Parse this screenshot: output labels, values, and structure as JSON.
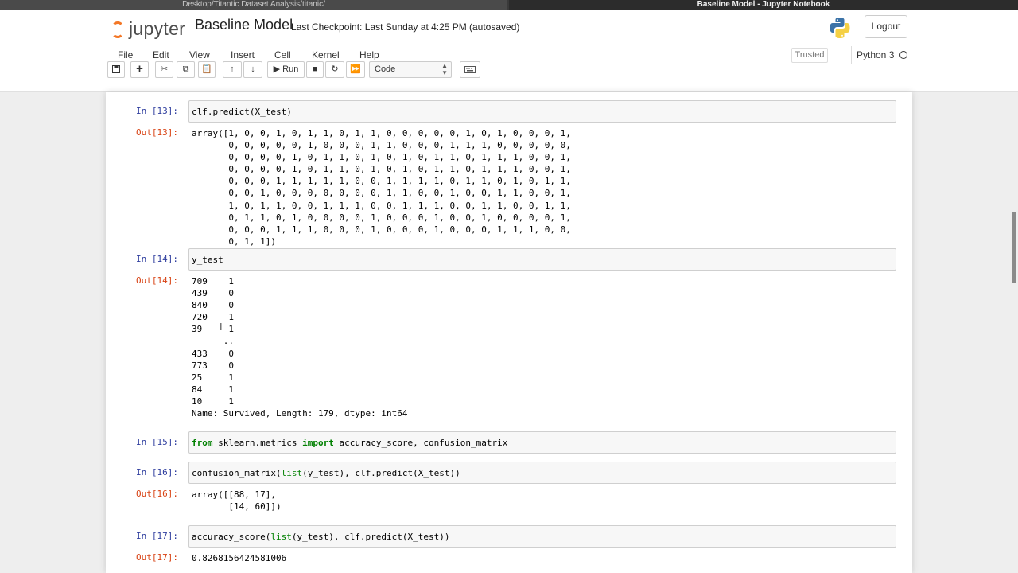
{
  "browser": {
    "tab1_title": "Desktop/Titantic Dataset Analysis/titanic/",
    "tab2_title": "Baseline Model - Jupyter Notebook"
  },
  "header": {
    "logo_text": "jupyter",
    "notebook_title": "Baseline Model",
    "checkpoint": "Last Checkpoint: Last Sunday at 4:25 PM",
    "autosaved": "(autosaved)",
    "logout_label": "Logout"
  },
  "menu": [
    "File",
    "Edit",
    "View",
    "Insert",
    "Cell",
    "Kernel",
    "Help"
  ],
  "kernel": {
    "trusted_label": "Trusted",
    "name": "Python 3"
  },
  "toolbar": {
    "run_label": "Run",
    "cell_type": "Code",
    "icons": [
      "save-icon",
      "add-cell-icon",
      "cut-icon",
      "copy-icon",
      "paste-icon",
      "move-up-icon",
      "move-down-icon",
      "run-icon",
      "stop-icon",
      "restart-icon",
      "fast-forward-icon",
      "keyboard-icon"
    ]
  },
  "cells": {
    "c13": {
      "in_prompt": "In [13]:",
      "code": "clf.predict(X_test)",
      "out_prompt": "Out[13]:",
      "output": "array([1, 0, 0, 1, 0, 1, 1, 0, 1, 1, 0, 0, 0, 0, 0, 1, 0, 1, 0, 0, 0, 1,\n       0, 0, 0, 0, 0, 1, 0, 0, 0, 1, 1, 0, 0, 0, 1, 1, 1, 0, 0, 0, 0, 0,\n       0, 0, 0, 0, 1, 0, 1, 1, 0, 1, 0, 1, 0, 1, 1, 0, 1, 1, 1, 0, 0, 1,\n       0, 0, 0, 0, 1, 0, 1, 1, 0, 1, 0, 1, 0, 1, 1, 0, 1, 1, 1, 0, 0, 1,\n       0, 0, 0, 1, 1, 1, 1, 1, 0, 0, 1, 1, 1, 1, 0, 1, 1, 0, 1, 0, 1, 1,\n       0, 0, 1, 0, 0, 0, 0, 0, 0, 0, 1, 1, 0, 0, 1, 0, 0, 1, 1, 0, 0, 1,\n       1, 0, 1, 1, 0, 0, 1, 1, 1, 0, 0, 1, 1, 1, 0, 0, 1, 1, 0, 0, 1, 1,\n       0, 1, 1, 0, 1, 0, 0, 0, 0, 1, 0, 0, 0, 1, 0, 0, 1, 0, 0, 0, 0, 1,\n       0, 0, 0, 1, 1, 1, 0, 0, 0, 1, 0, 0, 0, 1, 0, 0, 0, 1, 1, 1, 0, 0,\n       0, 1, 1])"
    },
    "c14": {
      "in_prompt": "In [14]:",
      "code": "y_test",
      "out_prompt": "Out[14]:",
      "output": "709    1\n439    0\n840    0\n720    1\n39     1\n      ..\n433    0\n773    0\n25     1\n84     1\n10     1\nName: Survived, Length: 179, dtype: int64"
    },
    "c15": {
      "in_prompt": "In [15]:",
      "kw_from": "from",
      "module": " sklearn.metrics ",
      "kw_import": "import",
      "names": " accuracy_score, confusion_matrix"
    },
    "c16": {
      "in_prompt": "In [16]:",
      "code_a": "confusion_matrix(",
      "builtin": "list",
      "code_b": "(y_test), clf.predict(X_test))",
      "out_prompt": "Out[16]:",
      "output": "array([[88, 17],\n       [14, 60]])"
    },
    "c17": {
      "in_prompt": "In [17]:",
      "code_a": "accuracy_score(",
      "builtin": "list",
      "code_b": "(y_test), clf.predict(X_test))",
      "out_prompt": "Out[17]:",
      "output": "0.8268156424581006"
    }
  }
}
